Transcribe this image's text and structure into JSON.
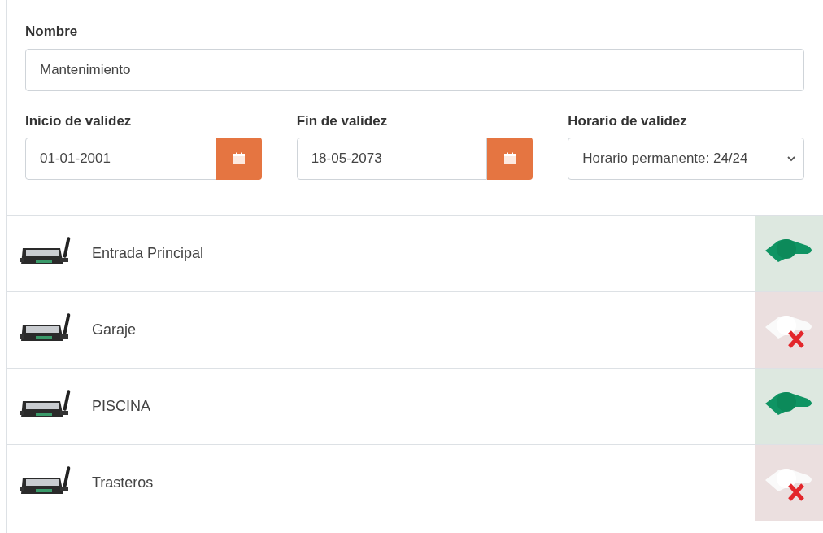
{
  "name_field": {
    "label": "Nombre",
    "value": "Mantenimiento"
  },
  "validity": [
    {
      "kind": "date",
      "label": "Inicio de validez",
      "value": "01-01-2001"
    },
    {
      "kind": "date",
      "label": "Fin de validez",
      "value": "18-05-2073"
    },
    {
      "kind": "select",
      "label": "Horario de validez",
      "value": "Horario permanente: 24/24"
    }
  ],
  "doors": [
    {
      "name": "Entrada Principal",
      "granted": true
    },
    {
      "name": "Garaje",
      "granted": false
    },
    {
      "name": "PISCINA",
      "granted": true
    },
    {
      "name": "Trasteros",
      "granted": false
    }
  ]
}
